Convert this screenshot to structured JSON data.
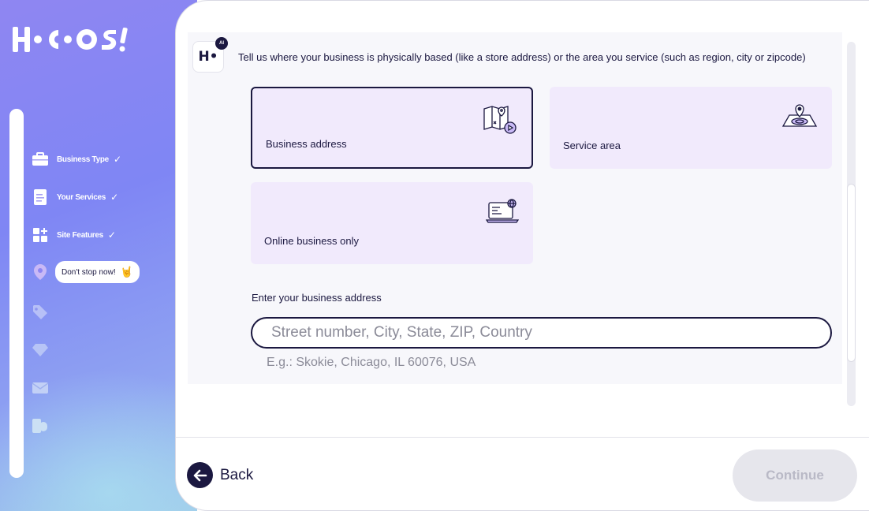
{
  "brand": {
    "logo_text": "H•C•O•S!"
  },
  "sidebar": {
    "steps": [
      {
        "label": "Business Type",
        "done": "✓",
        "icon": "briefcase-icon"
      },
      {
        "label": "Your Services",
        "done": "✓",
        "icon": "document-icon"
      },
      {
        "label": "Site Features",
        "done": "✓",
        "icon": "grid-plus-icon"
      },
      {
        "label": "Don't stop now!",
        "emoji": "🤘",
        "icon": "location-pin-icon"
      },
      {
        "icon": "tag-icon"
      },
      {
        "icon": "diamond-icon"
      },
      {
        "icon": "envelope-icon"
      },
      {
        "icon": "pages-icon"
      }
    ]
  },
  "assistant": {
    "avatar_text": "H•",
    "badge": "AI",
    "message": "Tell us where your business is physically based (like a store address) or the area you service (such as region, city or zipcode)"
  },
  "options": [
    {
      "label": "Business address",
      "icon": "map-pin-icon",
      "selected": true
    },
    {
      "label": "Service area",
      "icon": "area-target-icon",
      "selected": false
    },
    {
      "label": "Online business only",
      "icon": "laptop-globe-icon",
      "selected": false
    }
  ],
  "address": {
    "label": "Enter your business address",
    "placeholder": "Street number, City, State, ZIP, Country",
    "value": "",
    "hint": "E.g.: Skokie, Chicago, IL 60076, USA"
  },
  "footer": {
    "back_label": "Back",
    "continue_label": "Continue"
  },
  "colors": {
    "primary": "#1b1840",
    "card_bg": "#f1eafc",
    "disabled_bg": "#e6e6ec",
    "disabled_text": "#b9b9c6"
  }
}
